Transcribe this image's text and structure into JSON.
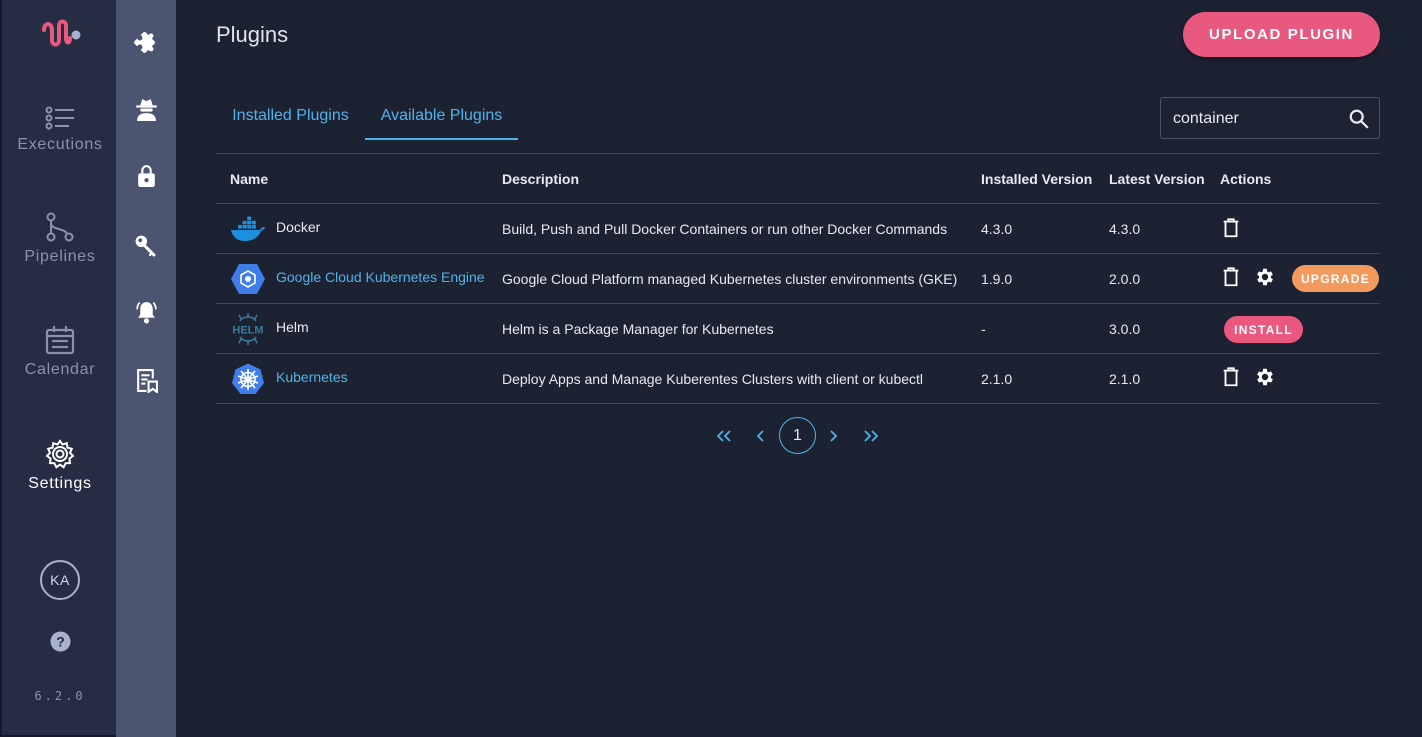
{
  "app": {
    "version": "6.2.0",
    "user_initials": "KA",
    "brand_color": "#e9587f",
    "accent_color": "#4fb3ea"
  },
  "nav": {
    "items": [
      {
        "label": "Executions",
        "icon": "list-icon"
      },
      {
        "label": "Pipelines",
        "icon": "pipeline-icon"
      },
      {
        "label": "Calendar",
        "icon": "calendar-icon"
      },
      {
        "label": "Settings",
        "icon": "gear-icon",
        "active": true
      }
    ]
  },
  "subnav": {
    "icons": [
      "puzzle-icon",
      "agent-icon",
      "lock-icon",
      "key-icon",
      "bell-icon",
      "report-icon"
    ],
    "active": "puzzle-icon"
  },
  "page": {
    "title": "Plugins",
    "upload_label": "UPLOAD PLUGIN"
  },
  "tabs": [
    {
      "label": "Installed Plugins",
      "active": false
    },
    {
      "label": "Available Plugins",
      "active": true
    }
  ],
  "search": {
    "value": "container",
    "placeholder": ""
  },
  "table": {
    "columns": [
      "Name",
      "Description",
      "Installed Version",
      "Latest Version",
      "Actions"
    ],
    "rows": [
      {
        "name": "Docker",
        "icon": "docker-icon",
        "link": false,
        "description": "Build, Push and Pull Docker Containers or run other Docker Commands",
        "installed": "4.3.0",
        "latest": "4.3.0",
        "actions": [
          "delete"
        ]
      },
      {
        "name": "Google Cloud Kubernetes Engine",
        "icon": "gke-icon",
        "link": true,
        "description": "Google Cloud Platform managed Kubernetes cluster environments (GKE)",
        "installed": "1.9.0",
        "latest": "2.0.0",
        "actions": [
          "delete",
          "settings",
          "upgrade"
        ],
        "upgrade_label": "UPGRADE"
      },
      {
        "name": "Helm",
        "icon": "helm-icon",
        "icon_text": "HELM",
        "link": false,
        "description": "Helm is a Package Manager for Kubernetes",
        "installed": "-",
        "latest": "3.0.0",
        "actions": [
          "install"
        ],
        "install_label": "INSTALL"
      },
      {
        "name": "Kubernetes",
        "icon": "kubernetes-icon",
        "link": true,
        "description": "Deploy Apps and Manage Kuberentes Clusters with client or kubectl",
        "installed": "2.1.0",
        "latest": "2.1.0",
        "actions": [
          "delete",
          "settings"
        ]
      }
    ]
  },
  "pagination": {
    "current_page": "1"
  }
}
